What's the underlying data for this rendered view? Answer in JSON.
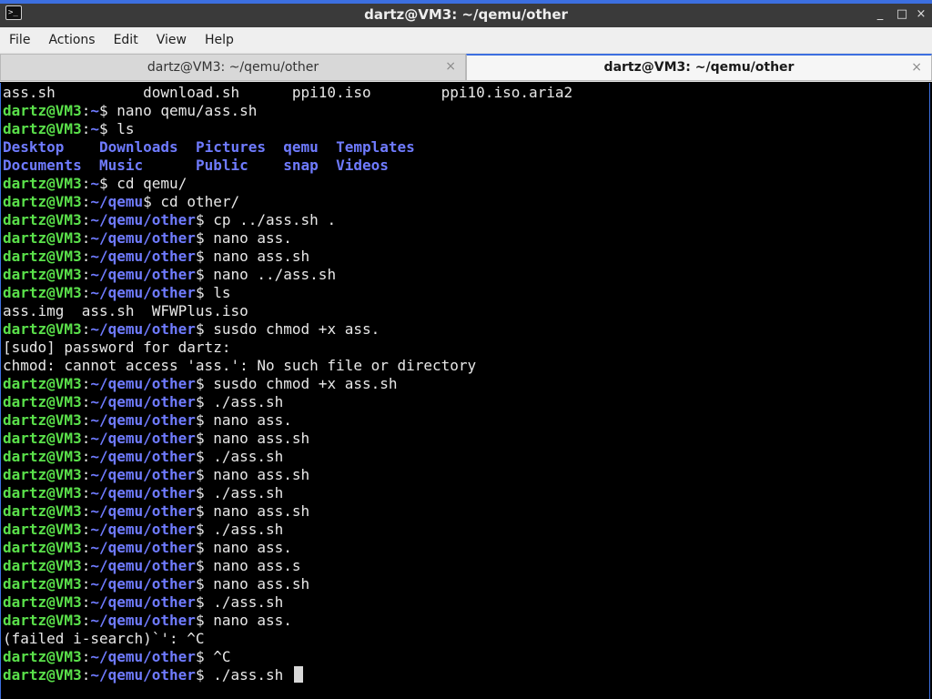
{
  "window": {
    "title": "dartz@VM3: ~/qemu/other",
    "app_icon_text": ">_",
    "controls": {
      "minimize": "_",
      "maximize": "□",
      "close": "×"
    },
    "accent_color": "#3c6fe0"
  },
  "menubar": {
    "items": [
      "File",
      "Actions",
      "Edit",
      "View",
      "Help"
    ]
  },
  "tabs": [
    {
      "label": "dartz@VM3: ~/qemu/other",
      "active": false,
      "close": "×"
    },
    {
      "label": "dartz@VM3: ~/qemu/other",
      "active": true,
      "close": "×"
    }
  ],
  "terminal": {
    "colors": {
      "userhost": "#5ae04a",
      "path": "#6f7bff",
      "text": "#e8e8e8",
      "background": "#000000"
    },
    "lines": [
      {
        "type": "output",
        "text": "ass.sh          download.sh      ppi10.iso        ppi10.iso.aria2"
      },
      {
        "type": "prompt",
        "user": "dartz@VM3",
        "sep": ":",
        "path": "~",
        "dollar": "$",
        "cmd": " nano qemu/ass.sh"
      },
      {
        "type": "prompt",
        "user": "dartz@VM3",
        "sep": ":",
        "path": "~",
        "dollar": "$",
        "cmd": " ls"
      },
      {
        "type": "dirs",
        "items": [
          "Desktop    ",
          "Downloads  ",
          "Pictures  ",
          "qemu  ",
          "Templates"
        ]
      },
      {
        "type": "dirs",
        "items": [
          "Documents  ",
          "Music      ",
          "Public    ",
          "snap  ",
          "Videos"
        ]
      },
      {
        "type": "prompt",
        "user": "dartz@VM3",
        "sep": ":",
        "path": "~",
        "dollar": "$",
        "cmd": " cd qemu/"
      },
      {
        "type": "prompt",
        "user": "dartz@VM3",
        "sep": ":",
        "path": "~/qemu",
        "dollar": "$",
        "cmd": " cd other/"
      },
      {
        "type": "prompt",
        "user": "dartz@VM3",
        "sep": ":",
        "path": "~/qemu/other",
        "dollar": "$",
        "cmd": " cp ../ass.sh ."
      },
      {
        "type": "prompt",
        "user": "dartz@VM3",
        "sep": ":",
        "path": "~/qemu/other",
        "dollar": "$",
        "cmd": " nano ass."
      },
      {
        "type": "prompt",
        "user": "dartz@VM3",
        "sep": ":",
        "path": "~/qemu/other",
        "dollar": "$",
        "cmd": " nano ass.sh"
      },
      {
        "type": "prompt",
        "user": "dartz@VM3",
        "sep": ":",
        "path": "~/qemu/other",
        "dollar": "$",
        "cmd": " nano ../ass.sh"
      },
      {
        "type": "prompt",
        "user": "dartz@VM3",
        "sep": ":",
        "path": "~/qemu/other",
        "dollar": "$",
        "cmd": " ls"
      },
      {
        "type": "output",
        "text": "ass.img  ass.sh  WFWPlus.iso"
      },
      {
        "type": "prompt",
        "user": "dartz@VM3",
        "sep": ":",
        "path": "~/qemu/other",
        "dollar": "$",
        "cmd": " susdo chmod +x ass."
      },
      {
        "type": "output",
        "text": "[sudo] password for dartz:"
      },
      {
        "type": "output",
        "text": "chmod: cannot access 'ass.': No such file or directory"
      },
      {
        "type": "prompt",
        "user": "dartz@VM3",
        "sep": ":",
        "path": "~/qemu/other",
        "dollar": "$",
        "cmd": " susdo chmod +x ass.sh"
      },
      {
        "type": "prompt",
        "user": "dartz@VM3",
        "sep": ":",
        "path": "~/qemu/other",
        "dollar": "$",
        "cmd": " ./ass.sh"
      },
      {
        "type": "prompt",
        "user": "dartz@VM3",
        "sep": ":",
        "path": "~/qemu/other",
        "dollar": "$",
        "cmd": " nano ass."
      },
      {
        "type": "prompt",
        "user": "dartz@VM3",
        "sep": ":",
        "path": "~/qemu/other",
        "dollar": "$",
        "cmd": " nano ass.sh"
      },
      {
        "type": "prompt",
        "user": "dartz@VM3",
        "sep": ":",
        "path": "~/qemu/other",
        "dollar": "$",
        "cmd": " ./ass.sh"
      },
      {
        "type": "prompt",
        "user": "dartz@VM3",
        "sep": ":",
        "path": "~/qemu/other",
        "dollar": "$",
        "cmd": " nano ass.sh"
      },
      {
        "type": "prompt",
        "user": "dartz@VM3",
        "sep": ":",
        "path": "~/qemu/other",
        "dollar": "$",
        "cmd": " ./ass.sh"
      },
      {
        "type": "prompt",
        "user": "dartz@VM3",
        "sep": ":",
        "path": "~/qemu/other",
        "dollar": "$",
        "cmd": " nano ass.sh"
      },
      {
        "type": "prompt",
        "user": "dartz@VM3",
        "sep": ":",
        "path": "~/qemu/other",
        "dollar": "$",
        "cmd": " ./ass.sh"
      },
      {
        "type": "prompt",
        "user": "dartz@VM3",
        "sep": ":",
        "path": "~/qemu/other",
        "dollar": "$",
        "cmd": " nano ass."
      },
      {
        "type": "prompt",
        "user": "dartz@VM3",
        "sep": ":",
        "path": "~/qemu/other",
        "dollar": "$",
        "cmd": " nano ass.s"
      },
      {
        "type": "prompt",
        "user": "dartz@VM3",
        "sep": ":",
        "path": "~/qemu/other",
        "dollar": "$",
        "cmd": " nano ass.sh"
      },
      {
        "type": "prompt",
        "user": "dartz@VM3",
        "sep": ":",
        "path": "~/qemu/other",
        "dollar": "$",
        "cmd": " ./ass.sh"
      },
      {
        "type": "prompt",
        "user": "dartz@VM3",
        "sep": ":",
        "path": "~/qemu/other",
        "dollar": "$",
        "cmd": " nano ass."
      },
      {
        "type": "output",
        "text": "(failed i-search)`': ^C"
      },
      {
        "type": "prompt",
        "user": "dartz@VM3",
        "sep": ":",
        "path": "~/qemu/other",
        "dollar": "$",
        "cmd": " ^C"
      },
      {
        "type": "prompt",
        "user": "dartz@VM3",
        "sep": ":",
        "path": "~/qemu/other",
        "dollar": "$",
        "cmd": " ./ass.sh ",
        "cursor": true
      }
    ]
  }
}
